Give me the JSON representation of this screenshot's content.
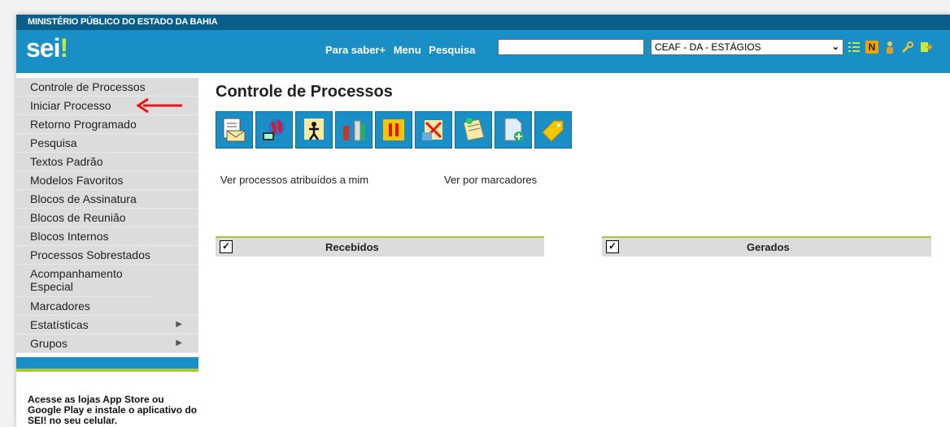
{
  "org_name": "MINISTÉRIO PÚBLICO DO ESTADO DA BAHIA",
  "logo": {
    "text": "sei",
    "mark": "!"
  },
  "nav": {
    "saber": "Para saber+",
    "menu": "Menu",
    "pesquisa": "Pesquisa"
  },
  "search": {
    "value": "",
    "placeholder": ""
  },
  "unit_selector": {
    "selected": "CEAF - DA - ESTÁGIOS"
  },
  "header_icons": [
    "list-icon",
    "notes-n-icon",
    "user-icon",
    "wrench-icon",
    "exit-icon"
  ],
  "sidebar": {
    "items": [
      {
        "label": "Controle de Processos"
      },
      {
        "label": "Iniciar Processo"
      },
      {
        "label": "Retorno Programado"
      },
      {
        "label": "Pesquisa"
      },
      {
        "label": "Textos Padrão"
      },
      {
        "label": "Modelos Favoritos"
      },
      {
        "label": "Blocos de Assinatura"
      },
      {
        "label": "Blocos de Reunião"
      },
      {
        "label": "Blocos Internos"
      },
      {
        "label": "Processos Sobrestados"
      },
      {
        "label": "Acompanhamento Especial"
      },
      {
        "label": "Marcadores"
      },
      {
        "label": "Estatísticas",
        "submenu": "▶"
      },
      {
        "label": "Grupos",
        "submenu": "▶"
      }
    ],
    "promo": "Acesse as lojas App Store ou Google Play e instale o aplicativo do SEI! no seu celular."
  },
  "main": {
    "title": "Controle de Processos",
    "toolbar_icons": [
      "send-process-icon",
      "globe-icon",
      "assign-user-icon",
      "books-icon",
      "pause-icon",
      "conclude-icon",
      "annotation-icon",
      "new-document-icon",
      "tag-icon"
    ],
    "view_assigned": "Ver processos atribuídos a mim",
    "view_markers": "Ver por marcadores",
    "tables": {
      "received": {
        "title": "Recebidos",
        "check": "✓"
      },
      "generated": {
        "title": "Gerados",
        "check": "✓"
      }
    }
  },
  "colors": {
    "header": "#1a8fc6",
    "topbar": "#0a5f8a",
    "accent": "#a7c93a",
    "sidebar": "#dcdcdc"
  }
}
